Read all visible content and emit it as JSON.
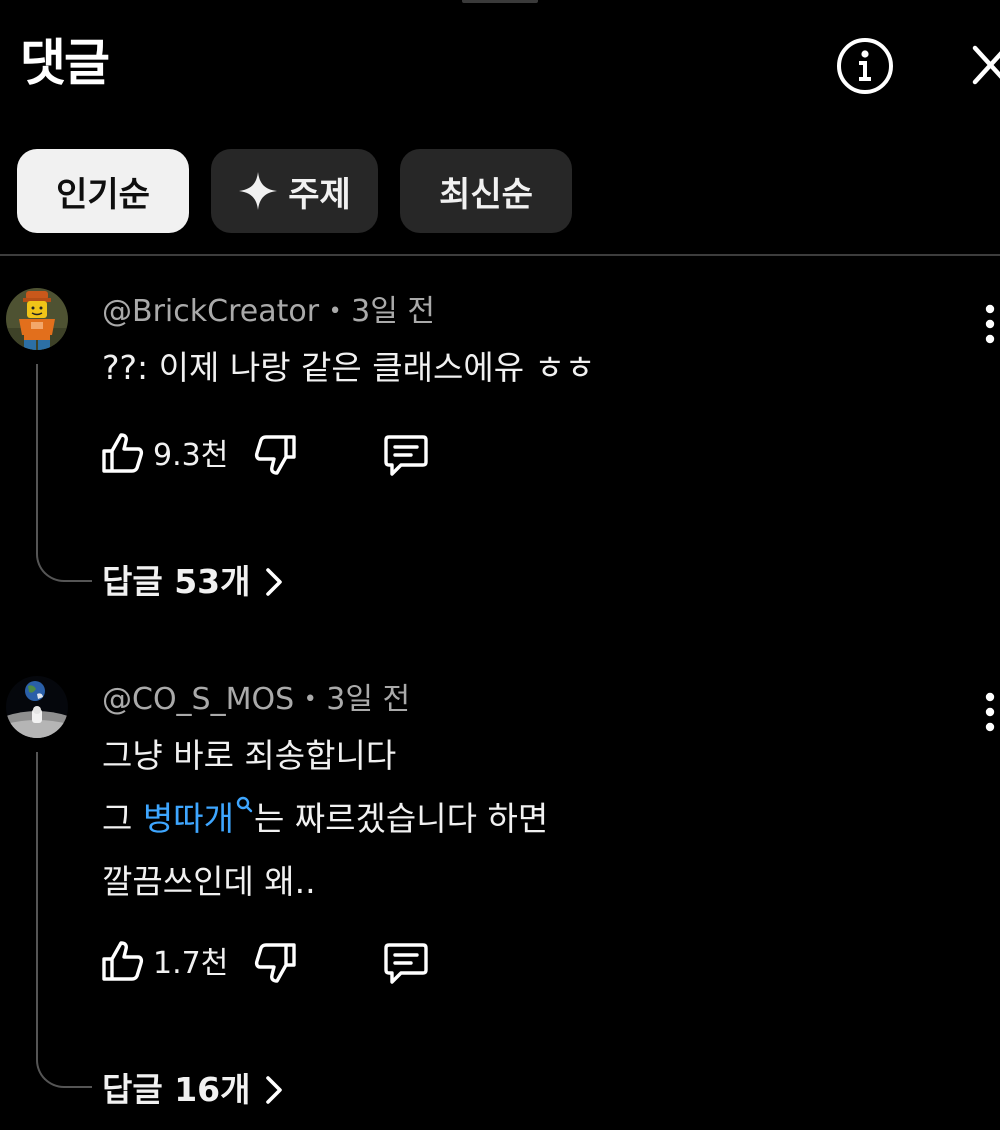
{
  "header": {
    "title": "댓글"
  },
  "filters": {
    "popular": "인기순",
    "topics": "주제",
    "newest": "최신순"
  },
  "comments": [
    {
      "author": "@BrickCreator",
      "separator": "•",
      "time": "3일 전",
      "lines": [
        "??: 이제 나랑 같은 클래스에유 ㅎㅎ"
      ],
      "likes": "9.3천",
      "replies": "답글 53개"
    },
    {
      "author": "@CO_S_MOS",
      "separator": "•",
      "time": "3일 전",
      "line1": "그냥 바로 죄송합니다",
      "line2_before": "그 ",
      "line2_link": "병따개",
      "line2_after": "는 짜르겠습니다 하면",
      "line3": "깔끔쓰인데 왜..",
      "likes": "1.7천",
      "replies": "답글 16개"
    }
  ],
  "colors": {
    "background": "#000000",
    "active_chip": "#f1f1f1",
    "inactive_chip": "#272727",
    "link": "#3ea6ff",
    "meta_text": "#aaaaaa"
  }
}
